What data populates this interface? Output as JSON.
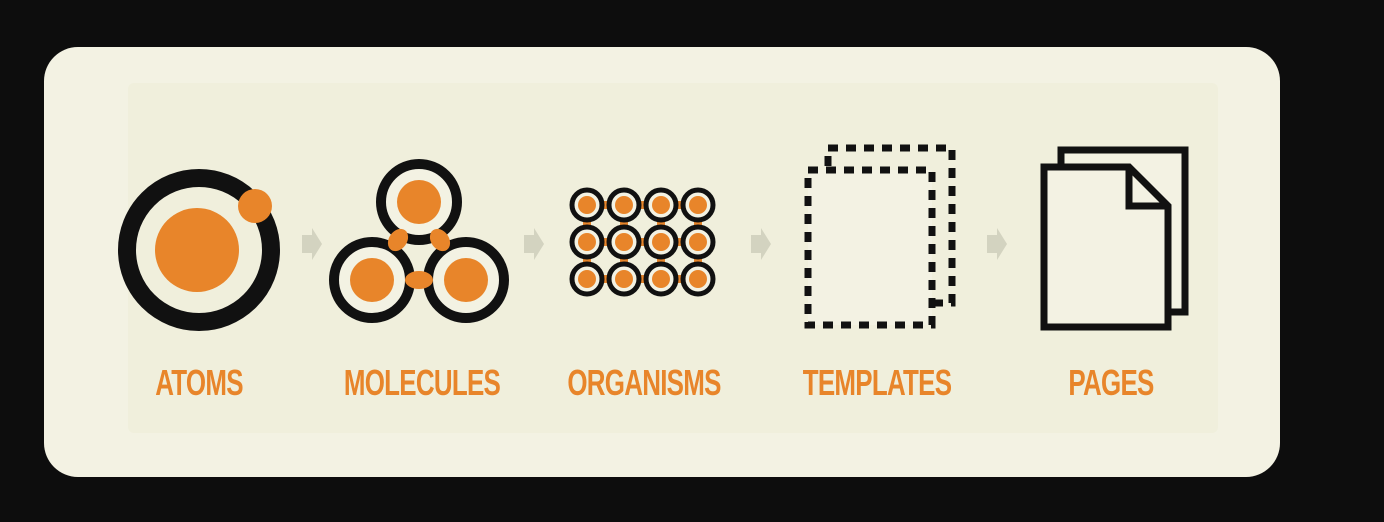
{
  "colors": {
    "background": "#0d0d0d",
    "card": "#f3f2e3",
    "accent": "#e8852a",
    "ink": "#111111",
    "arrow": "#d3d3c0"
  },
  "stages": [
    {
      "label": "ATOMS",
      "icon": "atom-icon"
    },
    {
      "label": "MOLECULES",
      "icon": "molecule-icon"
    },
    {
      "label": "ORGANISMS",
      "icon": "organism-icon"
    },
    {
      "label": "TEMPLATES",
      "icon": "template-icon"
    },
    {
      "label": "PAGES",
      "icon": "pages-icon"
    }
  ]
}
